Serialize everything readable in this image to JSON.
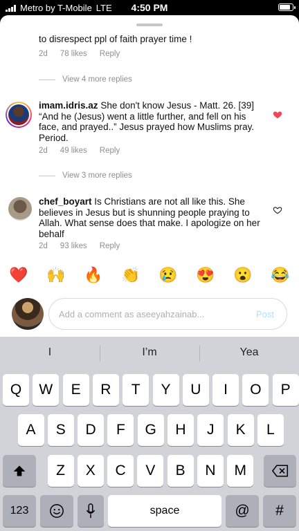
{
  "status_bar": {
    "carrier": "Metro by T-Mobile",
    "network": "LTE",
    "time": "4:50 PM",
    "battery_fraction": 0.85
  },
  "comments": [
    {
      "text": "to disrespect ppl of faith prayer time !",
      "age": "2d",
      "likes": "78 likes",
      "reply": "Reply"
    },
    {
      "username": "imam.idris.az",
      "text": "She don't know Jesus - Matt. 26. [39] “And he (Jesus) went a little further, and fell on his face, and prayed..” Jesus prayed how Muslims pray. Period.",
      "age": "2d",
      "likes": "49 likes",
      "reply": "Reply",
      "liked": true
    },
    {
      "username": "chef_boyart",
      "text": "Is Christians are not all like this. She believes in Jesus but is shunning people praying to Allah. What sense does that make. I apologize on her behalf",
      "age": "2d",
      "likes": "93 likes",
      "reply": "Reply",
      "liked": false
    }
  ],
  "view_replies": [
    "View 4 more replies",
    "View 3 more replies"
  ],
  "emojis": [
    "❤️",
    "🙌",
    "🔥",
    "👏",
    "😢",
    "😍",
    "😮",
    "😂"
  ],
  "comment_box": {
    "placeholder": "Add a comment as aseeyahzainab...",
    "post": "Post"
  },
  "keyboard": {
    "suggestions": [
      "I",
      "I’m",
      "Yea"
    ],
    "row1": [
      "Q",
      "W",
      "E",
      "R",
      "T",
      "Y",
      "U",
      "I",
      "O",
      "P"
    ],
    "row2": [
      "A",
      "S",
      "D",
      "F",
      "G",
      "H",
      "J",
      "K",
      "L"
    ],
    "row3": [
      "Z",
      "X",
      "C",
      "V",
      "B",
      "N",
      "M"
    ],
    "numbers": "123",
    "space": "space",
    "at": "@",
    "hash": "#"
  },
  "colors": {
    "liked_heart": "#ed4956",
    "post_disabled": "#b2dffc"
  }
}
